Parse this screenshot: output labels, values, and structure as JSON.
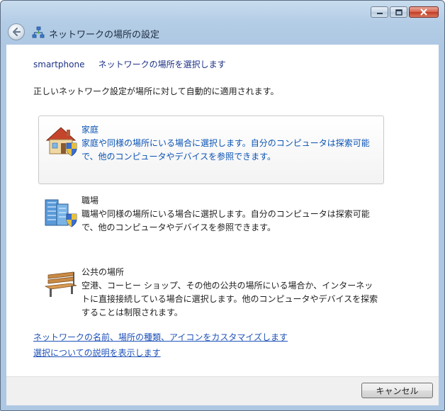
{
  "window": {
    "title": "ネットワークの場所の設定"
  },
  "caption": {
    "minimize": "minimize-icon",
    "maximize": "maximize-icon",
    "close": "close-icon"
  },
  "header": {
    "network_name": "smartphone",
    "instruction": "ネットワークの場所を選択します"
  },
  "description": "正しいネットワーク設定が場所に対して自動的に適用されます。",
  "options": [
    {
      "title": "家庭",
      "text": "家庭や同様の場所にいる場合に選択します。自分のコンピュータは探索可能で、他のコンピュータやデバイスを参照できます。",
      "icon": "house-icon",
      "selected": true
    },
    {
      "title": "職場",
      "text": "職場や同様の場所にいる場合に選択します。自分のコンピュータは探索可能で、他のコンピュータやデバイスを参照できます。",
      "icon": "office-building-icon",
      "selected": false
    },
    {
      "title": "公共の場所",
      "text": "空港、コーヒー ショップ、その他の公共の場所にいる場合か、インターネットに直接接続している場合に選択します。他のコンピュータやデバイスを探索することは制限されます。",
      "icon": "park-bench-icon",
      "selected": false
    }
  ],
  "links": {
    "customize": "ネットワークの名前、場所の種類、アイコンをカスタマイズします",
    "help": "選択についての説明を表示します"
  },
  "footer": {
    "cancel_label": "キャンセル"
  },
  "colors": {
    "link": "#1f52b8",
    "heading": "#1e3287",
    "selected_text": "#0a53b5",
    "frame": "#aec8e3"
  }
}
